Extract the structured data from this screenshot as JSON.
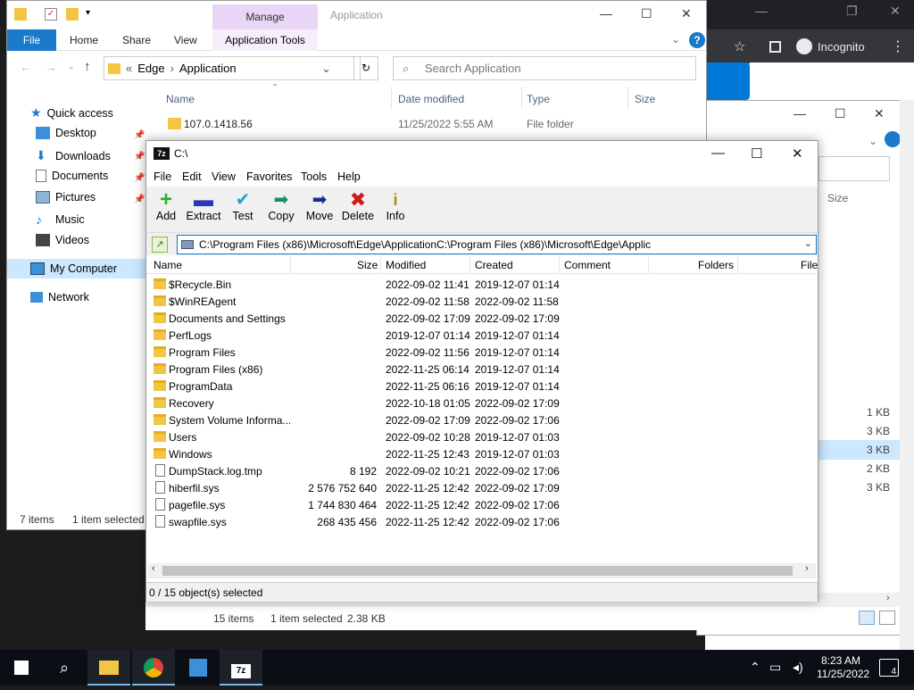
{
  "chrome": {
    "incognito_label": "Incognito"
  },
  "explorer_back": {
    "size_header": "Size",
    "sizes": [
      "1 KB",
      "3 KB",
      "3 KB",
      "2 KB",
      "3 KB"
    ]
  },
  "explorer": {
    "context_tab": "Manage",
    "title": "Application",
    "ribbon_tabs": [
      "File",
      "Home",
      "Share",
      "View"
    ],
    "context_ribbon_tab": "Application Tools",
    "help_label": "?",
    "breadcrumb": [
      "Edge",
      "Application"
    ],
    "search_placeholder": "Search Application",
    "columns": {
      "name": "Name",
      "date": "Date modified",
      "type": "Type",
      "size": "Size"
    },
    "first_row": {
      "name": "107.0.1418.56",
      "date": "11/25/2022 5:55 AM",
      "type": "File folder"
    },
    "nav": {
      "quick_access": "Quick access",
      "desktop": "Desktop",
      "downloads": "Downloads",
      "documents": "Documents",
      "pictures": "Pictures",
      "music": "Music",
      "videos": "Videos",
      "my_computer": "My Computer",
      "network": "Network"
    },
    "status": {
      "items": "7 items",
      "selected": "1 item selected"
    }
  },
  "zip": {
    "title": "C:\\",
    "menu": [
      "File",
      "Edit",
      "View",
      "Favorites",
      "Tools",
      "Help"
    ],
    "toolbar": [
      "Add",
      "Extract",
      "Test",
      "Copy",
      "Move",
      "Delete",
      "Info"
    ],
    "path": "C:\\Program Files (x86)\\Microsoft\\Edge\\ApplicationC:\\Program Files (x86)\\Microsoft\\Edge\\Applic",
    "columns": {
      "name": "Name",
      "size": "Size",
      "modified": "Modified",
      "created": "Created",
      "comment": "Comment",
      "folders": "Folders",
      "files": "File"
    },
    "rows": [
      {
        "name": "$Recycle.Bin",
        "size": "",
        "modified": "2022-09-02 11:41",
        "created": "2019-12-07 01:14",
        "kind": "folder"
      },
      {
        "name": "$WinREAgent",
        "size": "",
        "modified": "2022-09-02 11:58",
        "created": "2022-09-02 11:58",
        "kind": "folder"
      },
      {
        "name": "Documents and Settings",
        "size": "",
        "modified": "2022-09-02 17:09",
        "created": "2022-09-02 17:09",
        "kind": "folder"
      },
      {
        "name": "PerfLogs",
        "size": "",
        "modified": "2019-12-07 01:14",
        "created": "2019-12-07 01:14",
        "kind": "folder"
      },
      {
        "name": "Program Files",
        "size": "",
        "modified": "2022-09-02 11:56",
        "created": "2019-12-07 01:14",
        "kind": "folder"
      },
      {
        "name": "Program Files (x86)",
        "size": "",
        "modified": "2022-11-25 06:14",
        "created": "2019-12-07 01:14",
        "kind": "folder"
      },
      {
        "name": "ProgramData",
        "size": "",
        "modified": "2022-11-25 06:16",
        "created": "2019-12-07 01:14",
        "kind": "folder"
      },
      {
        "name": "Recovery",
        "size": "",
        "modified": "2022-10-18 01:05",
        "created": "2022-09-02 17:09",
        "kind": "folder"
      },
      {
        "name": "System Volume Informa...",
        "size": "",
        "modified": "2022-09-02 17:09",
        "created": "2022-09-02 17:06",
        "kind": "folder"
      },
      {
        "name": "Users",
        "size": "",
        "modified": "2022-09-02 10:28",
        "created": "2019-12-07 01:03",
        "kind": "folder"
      },
      {
        "name": "Windows",
        "size": "",
        "modified": "2022-11-25 12:43",
        "created": "2019-12-07 01:03",
        "kind": "folder"
      },
      {
        "name": "DumpStack.log.tmp",
        "size": "8 192",
        "modified": "2022-09-02 10:21",
        "created": "2022-09-02 17:06",
        "kind": "file"
      },
      {
        "name": "hiberfil.sys",
        "size": "2 576 752 640",
        "modified": "2022-11-25 12:42",
        "created": "2022-09-02 17:09",
        "kind": "file"
      },
      {
        "name": "pagefile.sys",
        "size": "1 744 830 464",
        "modified": "2022-11-25 12:42",
        "created": "2022-09-02 17:06",
        "kind": "file"
      },
      {
        "name": "swapfile.sys",
        "size": "268 435 456",
        "modified": "2022-11-25 12:42",
        "created": "2022-09-02 17:06",
        "kind": "file"
      }
    ],
    "status": "0 / 15 object(s) selected"
  },
  "explorer_bottom": {
    "items": "15 items",
    "selected": "1 item selected",
    "size": "2.38 KB"
  },
  "taskbar": {
    "time": "8:23 AM",
    "date": "11/25/2022",
    "notifications": "4"
  },
  "colors": {
    "accent": "#0078d7",
    "file_tab": "#1979ca",
    "manage_tab": "#e9d5f5",
    "selection": "#cce8ff"
  }
}
